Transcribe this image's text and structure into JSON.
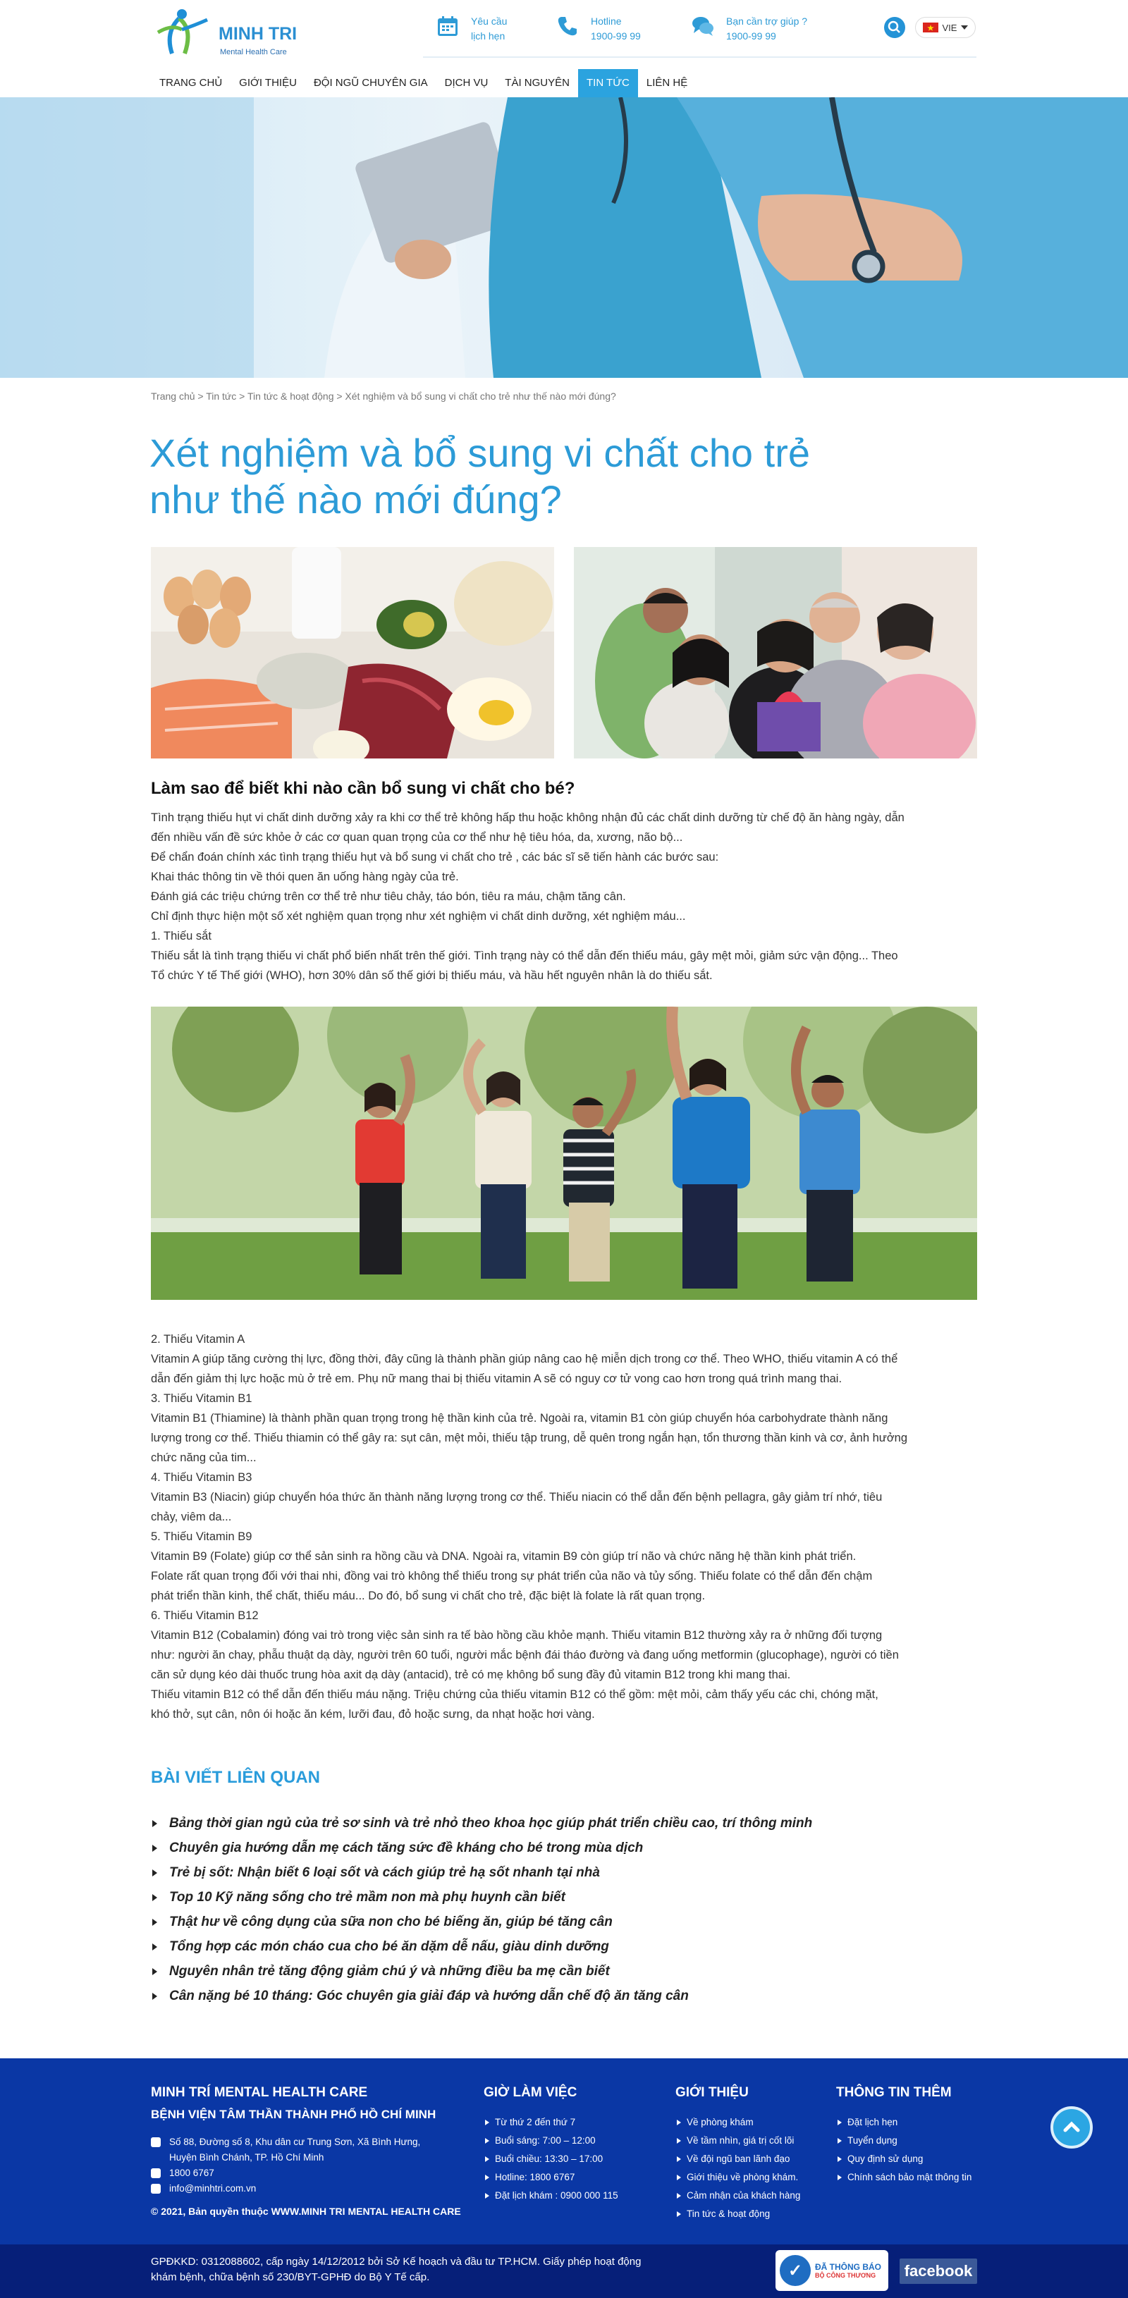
{
  "header": {
    "logo_title": "MINH TRI",
    "logo_subtitle": "Mental Health Care",
    "appointment_line1": "Yêu cầu",
    "appointment_line2": "lịch hẹn",
    "hotline_label": "Hotline",
    "hotline_number": "1900-99 99",
    "help_label": "Bạn cần trợ giúp ?",
    "help_number": "1900-99 99",
    "language": "VIE"
  },
  "nav": [
    "TRANG CHỦ",
    "GIỚI THIỆU",
    "ĐỘI NGŨ CHUYÊN GIA",
    "DỊCH VỤ",
    "TÀI NGUYÊN",
    "TIN TỨC",
    "LIÊN HỆ"
  ],
  "nav_active_index": 5,
  "breadcrumb": "Trang chủ > Tin tức > Tin tức & hoạt động > Xét nghiệm và bổ sung vi chất cho trẻ như thế nào mới đúng?",
  "article": {
    "title_line1": "Xét nghiệm và bổ sung vi chất cho trẻ",
    "title_line2": "như thế nào mới đúng?",
    "subheading": "Làm sao để biết khi nào cần bổ sung vi chất cho bé?",
    "block1": [
      "Tình trạng thiếu hụt vi chất dinh dưỡng xảy ra khi cơ thể trẻ không hấp thu hoặc không nhận đủ các chất dinh dưỡng từ chế độ ăn hàng ngày, dẫn",
      "đến nhiều vấn đề sức khỏe ở các cơ quan quan trọng của cơ thể như hệ tiêu hóa, da, xương, não bộ...",
      "Để chẩn đoán chính xác tình trạng thiếu hụt và bổ sung vi chất cho trẻ , các bác sĩ sẽ tiến hành các bước sau:",
      "Khai thác thông tin về thói quen ăn uống hàng ngày của trẻ.",
      "Đánh giá các triệu chứng trên cơ thể trẻ như tiêu chảy, táo bón, tiêu ra máu, chậm tăng cân.",
      "Chỉ định thực hiện một số xét nghiệm quan trọng như xét nghiệm vi chất dinh dưỡng, xét nghiệm máu...",
      "1. Thiếu sắt",
      "Thiếu sắt là tình trạng thiếu vi chất phổ biến nhất trên thế giới. Tình trạng này có thể dẫn đến thiếu máu, gây mệt mỏi, giảm sức vận động... Theo",
      "Tổ chức Y tế Thế giới (WHO), hơn 30% dân số thế giới bị thiếu máu, và hầu hết nguyên nhân là do thiếu sắt."
    ],
    "block2": [
      "2. Thiếu Vitamin A",
      "Vitamin A giúp tăng cường thị lực, đồng thời, đây cũng là thành phần giúp nâng cao hệ miễn dịch trong cơ thể. Theo WHO, thiếu vitamin A có thể",
      "dẫn đến giảm thị lực hoặc mù ở trẻ em. Phụ nữ mang thai bị thiếu vitamin A sẽ có nguy cơ tử vong cao hơn trong quá trình mang thai.",
      "3. Thiếu Vitamin B1",
      "Vitamin B1 (Thiamine) là thành phần quan trọng trong hệ thần kinh của trẻ. Ngoài ra, vitamin B1 còn giúp chuyển hóa carbohydrate thành năng",
      "lượng trong cơ thể. Thiếu thiamin có thể gây ra: sụt cân, mệt mỏi, thiếu tập trung, dễ quên trong ngắn hạn, tổn thương thần kinh và cơ, ảnh hưởng",
      "chức năng của tim...",
      "4. Thiếu Vitamin B3",
      "Vitamin B3 (Niacin) giúp chuyển hóa thức ăn thành năng lượng trong cơ thể. Thiếu niacin có thể dẫn đến bệnh pellagra, gây giảm trí nhớ, tiêu",
      "chảy, viêm da...",
      "5. Thiếu Vitamin B9",
      "Vitamin B9 (Folate) giúp cơ thể sản sinh ra hồng cầu và DNA. Ngoài ra, vitamin B9 còn giúp trí não và chức năng hệ thần kinh phát triển.",
      "Folate rất quan trọng đối với thai nhi, đồng vai trò không thể thiếu trong sự phát triển của não và tủy sống. Thiếu folate có thể dẫn đến chậm",
      "phát triển thần kinh, thể chất, thiếu máu... Do đó, bổ sung vi chất cho trẻ, đặc biệt là folate là rất quan trọng.",
      "6. Thiếu Vitamin B12",
      "Vitamin B12 (Cobalamin) đóng vai trò trong việc sản sinh ra tế bào hồng cầu khỏe mạnh. Thiếu vitamin B12 thường xảy ra ở những đối tượng",
      "như: người ăn chay, phẫu thuật dạ dày, người trên 60 tuổi, người mắc bệnh đái tháo đường và đang uống metformin (glucophage), người có tiền",
      "căn sử dụng kéo dài thuốc trung hòa axit dạ dày (antacid), trẻ có mẹ không bổ sung đầy đủ vitamin B12 trong khi mang thai.",
      "Thiếu vitamin B12 có thể dẫn đến thiếu máu nặng. Triệu chứng của thiếu vitamin B12 có thể gồm: mệt mỏi, cảm thấy yếu các chi, chóng mặt,",
      "khó thở, sụt cân, nôn ói hoặc ăn kém, lưỡi đau, đỏ hoặc sưng, da nhạt hoặc hơi vàng."
    ]
  },
  "related": {
    "title": "BÀI VIẾT LIÊN QUAN",
    "items": [
      "Bảng thời gian ngủ của trẻ sơ sinh và trẻ nhỏ theo khoa học giúp phát triển chiều cao, trí thông minh",
      "Chuyên gia hướng dẫn mẹ cách tăng sức đề kháng cho bé trong mùa dịch",
      "Trẻ bị sốt: Nhận biết 6 loại sốt và cách giúp trẻ hạ sốt nhanh tại nhà",
      "Top 10 Kỹ năng sống cho trẻ mầm non mà phụ huynh cần biết",
      "Thật hư về công dụng của sữa non cho bé biếng ăn, giúp bé tăng cân",
      "Tổng hợp các món cháo cua cho bé ăn dặm dễ nấu, giàu dinh dưỡng",
      "Nguyên nhân trẻ tăng động giảm chú ý và những điều ba mẹ cần biết",
      "Cân nặng bé 10 tháng: Góc chuyên gia giải đáp và hướng dẫn chế độ ăn tăng cân"
    ]
  },
  "footer": {
    "org_title": "MINH TRÍ MENTAL HEALTH CARE",
    "org_subtitle": "BỆNH VIỆN TÂM THẦN THÀNH PHỐ HỒ CHÍ MINH",
    "address_line1": "Số 88, Đường số 8, Khu dân cư Trung Sơn, Xã Bình Hưng,",
    "address_line2": "Huyện Bình Chánh, TP. Hồ Chí Minh",
    "phone": "1800 6767",
    "email": "info@minhtri.com.vn",
    "copyright": "© 2021, Bản quyền thuộc WWW.MINH TRI MENTAL HEALTH CARE",
    "hours_title": "GIỜ LÀM VIỆC",
    "hours": [
      "Từ thứ 2 đến thứ 7",
      "Buổi sáng: 7:00 – 12:00",
      "Buổi chiều: 13:30 – 17:00",
      "Hotline: 1800 6767",
      "Đặt lịch khám : 0900 000 115"
    ],
    "intro_title": "GIỚI THIỆU",
    "intro": [
      "Về phòng khám",
      "Về tầm nhìn, giá trị cốt lõi",
      "Về đội ngũ ban lãnh đạo",
      "Giới thiệu về phòng khám.",
      "Cảm nhận của khách hàng",
      "Tin tức & hoạt động"
    ],
    "more_title": "THÔNG TIN THÊM",
    "more": [
      "Đặt lịch hẹn",
      "Tuyển dụng",
      "Quy định sử dụng",
      "Chính sách bảo mật thông tin"
    ],
    "license_line1": "GPĐKKD: 0312088602, cấp ngày 14/12/2012 bởi Sở Kế hoạch và đầu tư TP.HCM. Giấy phép hoạt động",
    "license_line2": "khám bệnh, chữa bệnh số 230/BYT-GPHĐ do Bộ Y Tế cấp.",
    "badge_line1": "ĐÃ THÔNG BÁO",
    "badge_line2": "BỘ CÔNG THƯƠNG",
    "facebook": "facebook"
  },
  "colors": {
    "accent": "#2c9bd7",
    "footer_bg": "#0a37a5",
    "footer_bottom": "#061f79",
    "nav_active": "#2ba3df"
  }
}
